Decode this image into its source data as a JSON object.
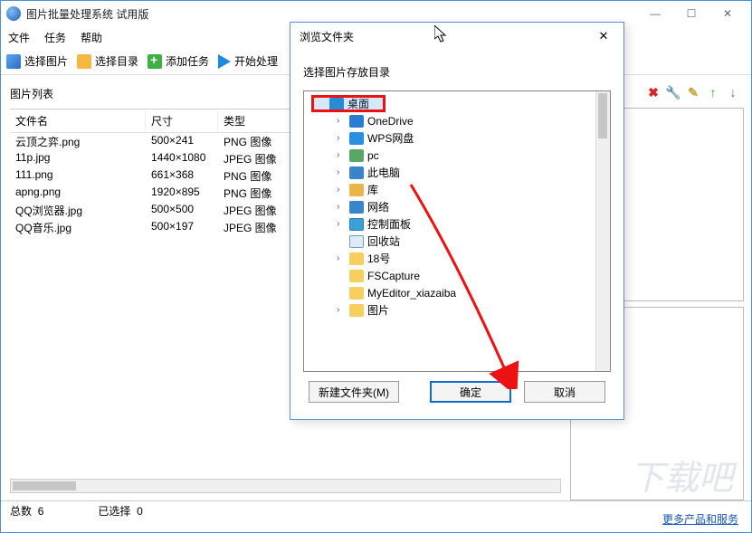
{
  "window": {
    "title": "图片批量处理系统 试用版"
  },
  "menu": {
    "file": "文件",
    "task": "任务",
    "help": "帮助"
  },
  "toolbar": {
    "select_image": "选择图片",
    "select_dir": "选择目录",
    "add_task": "添加任务",
    "start": "开始处理"
  },
  "list": {
    "title": "图片列表",
    "col_name": "文件名",
    "col_size": "尺寸",
    "col_type": "类型",
    "rows": [
      {
        "name": "云顶之弈.png",
        "size": "500×241",
        "type": "PNG 图像"
      },
      {
        "name": "11p.jpg",
        "size": "1440×1080",
        "type": "JPEG 图像"
      },
      {
        "name": "111.png",
        "size": "661×368",
        "type": "PNG 图像"
      },
      {
        "name": "apng.png",
        "size": "1920×895",
        "type": "PNG 图像"
      },
      {
        "name": "QQ浏览器.jpg",
        "size": "500×500",
        "type": "JPEG 图像"
      },
      {
        "name": "QQ音乐.jpg",
        "size": "500×197",
        "type": "JPEG 图像"
      }
    ]
  },
  "status": {
    "total_label": "总数",
    "total": "6",
    "selected_label": "已选择",
    "selected": "0"
  },
  "footer_link": "更多产品和服务",
  "dialog": {
    "title": "浏览文件夹",
    "label": "选择图片存放目录",
    "tree": [
      {
        "label": "桌面",
        "icon": "desktop",
        "level": 1,
        "exp": ""
      },
      {
        "label": "OneDrive",
        "icon": "cloud",
        "level": 2,
        "exp": "›"
      },
      {
        "label": "WPS网盘",
        "icon": "wps",
        "level": 2,
        "exp": "›"
      },
      {
        "label": "pc",
        "icon": "user",
        "level": 2,
        "exp": "›"
      },
      {
        "label": "此电脑",
        "icon": "pc",
        "level": 2,
        "exp": "›"
      },
      {
        "label": "库",
        "icon": "lib",
        "level": 2,
        "exp": "›"
      },
      {
        "label": "网络",
        "icon": "net",
        "level": 2,
        "exp": "›"
      },
      {
        "label": "控制面板",
        "icon": "cp",
        "level": 2,
        "exp": "›"
      },
      {
        "label": "回收站",
        "icon": "recycle",
        "level": 2,
        "exp": ""
      },
      {
        "label": "18号",
        "icon": "fold",
        "level": 2,
        "exp": "›"
      },
      {
        "label": "FSCapture",
        "icon": "fold",
        "level": 2,
        "exp": ""
      },
      {
        "label": "MyEditor_xiazaiba",
        "icon": "fold",
        "level": 2,
        "exp": ""
      },
      {
        "label": "图片",
        "icon": "fold",
        "level": 2,
        "exp": "›"
      }
    ],
    "new_folder": "新建文件夹(M)",
    "ok": "确定",
    "cancel": "取消"
  }
}
